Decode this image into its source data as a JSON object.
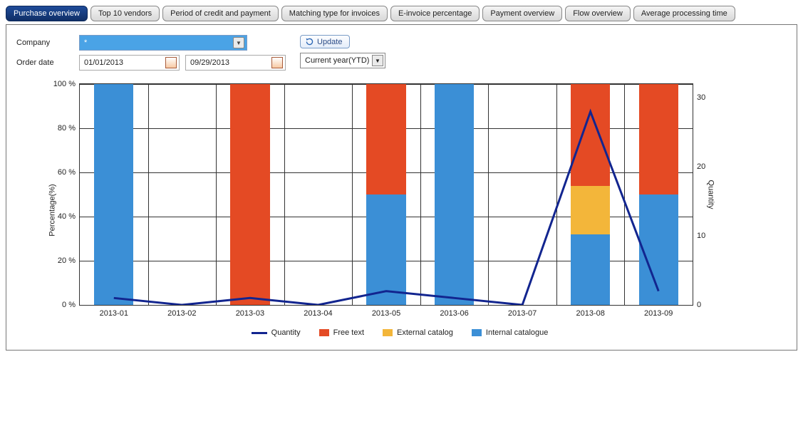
{
  "tabs": [
    {
      "id": "purchase-overview",
      "label": "Purchase overview",
      "active": true
    },
    {
      "id": "top-10-vendors",
      "label": "Top 10 vendors"
    },
    {
      "id": "period-of-credit",
      "label": "Period of credit and payment"
    },
    {
      "id": "matching-type",
      "label": "Matching type for invoices"
    },
    {
      "id": "e-invoice-pct",
      "label": "E-invoice percentage"
    },
    {
      "id": "payment-overview",
      "label": "Payment overview"
    },
    {
      "id": "flow-overview",
      "label": "Flow overview"
    },
    {
      "id": "avg-processing",
      "label": "Average processing time"
    }
  ],
  "filters": {
    "company_label": "Company",
    "company_value": "*",
    "order_date_label": "Order date",
    "date_from": "01/01/2013",
    "date_to": "09/29/2013",
    "update_label": "Update",
    "range_value": "Current year(YTD)"
  },
  "chart_data": {
    "type": "bar",
    "categories": [
      "2013-01",
      "2013-02",
      "2013-03",
      "2013-04",
      "2013-05",
      "2013-06",
      "2013-07",
      "2013-08",
      "2013-09"
    ],
    "series": [
      {
        "name": "Internal catalogue",
        "color": "#3b8fd6",
        "values": [
          100,
          0,
          0,
          0,
          50,
          100,
          0,
          32,
          50
        ]
      },
      {
        "name": "External catalog",
        "color": "#f3b63a",
        "values": [
          0,
          0,
          0,
          0,
          0,
          0,
          0,
          22,
          0
        ]
      },
      {
        "name": "Free text",
        "color": "#e44a24",
        "values": [
          0,
          0,
          100,
          0,
          50,
          0,
          0,
          46,
          50
        ]
      }
    ],
    "line": {
      "name": "Quantity",
      "color": "#12258f",
      "values": [
        1,
        0,
        1,
        0,
        2,
        1,
        0,
        28,
        2
      ]
    },
    "ylabel_left": "Percentage(%)",
    "ylim_left": [
      0,
      100
    ],
    "yticks_left": [
      "0 %",
      "20 %",
      "40 %",
      "60 %",
      "80 %",
      "100 %"
    ],
    "ylabel_right": "Quantity",
    "ylim_right": [
      0,
      32
    ],
    "yticks_right": [
      "0",
      "10",
      "20",
      "30"
    ],
    "legend": [
      "Quantity",
      "Free text",
      "External catalog",
      "Internal catalogue"
    ]
  }
}
